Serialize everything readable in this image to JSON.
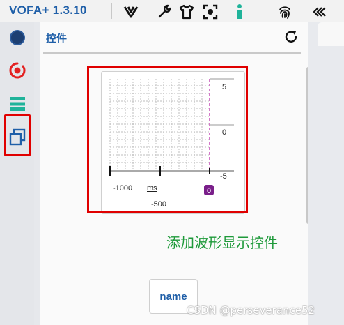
{
  "app": {
    "title": "VOFA+ 1.3.10"
  },
  "panel": {
    "title": "控件"
  },
  "waveform": {
    "y_ticks": [
      "5",
      "0",
      "-5"
    ],
    "x_tick_left": "-1000",
    "x_tick_mid": "-500",
    "x_unit": "ms",
    "channel_badge": "0"
  },
  "annotation": "添加波形显示控件",
  "button": {
    "label": "name"
  },
  "watermark": "CSDN @perseverance52",
  "colors": {
    "accent": "#1f5fa8",
    "highlight": "#e00000",
    "annotation": "#1e9a3a",
    "marker": "#c040b0",
    "badge": "#7a1f8a"
  }
}
